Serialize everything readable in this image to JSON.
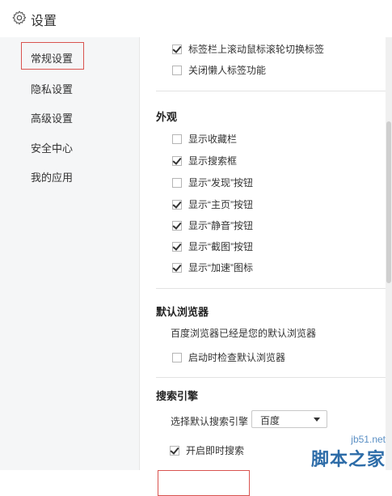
{
  "header": {
    "title": "设置",
    "icon": "gear-icon"
  },
  "sidebar": {
    "items": [
      {
        "label": "常规设置",
        "active": true
      },
      {
        "label": "隐私设置"
      },
      {
        "label": "高级设置"
      },
      {
        "label": "安全中心"
      },
      {
        "label": "我的应用"
      }
    ]
  },
  "tabs_section": {
    "options": [
      {
        "label": "标签栏上滚动鼠标滚轮切换标签",
        "checked": true
      },
      {
        "label": "关闭懒人标签功能",
        "checked": false
      }
    ]
  },
  "appearance": {
    "title": "外观",
    "options": [
      {
        "label": "显示收藏栏",
        "checked": false
      },
      {
        "label": "显示搜索框",
        "checked": true
      },
      {
        "label": "显示“发现”按钮",
        "checked": false
      },
      {
        "label": "显示“主页”按钮",
        "checked": true
      },
      {
        "label": "显示“静音”按钮",
        "checked": true
      },
      {
        "label": "显示“截图”按钮",
        "checked": true
      },
      {
        "label": "显示“加速”图标",
        "checked": true
      }
    ]
  },
  "default_browser": {
    "title": "默认浏览器",
    "status": "百度浏览器已经是您的默认浏览器",
    "check_on_start": {
      "label": "启动时检查默认浏览器",
      "checked": false
    }
  },
  "search_engine": {
    "title": "搜索引擎",
    "select_label": "选择默认搜索引擎",
    "selected": "百度",
    "instant_search": {
      "label": "开启即时搜索",
      "checked": true
    }
  },
  "watermark": {
    "domain": "jb51.net",
    "name": "脚本之家"
  },
  "colors": {
    "highlight_border": "#d9534f",
    "sidebar_bg": "#f5f6f7",
    "watermark": "#2d6ca8"
  }
}
